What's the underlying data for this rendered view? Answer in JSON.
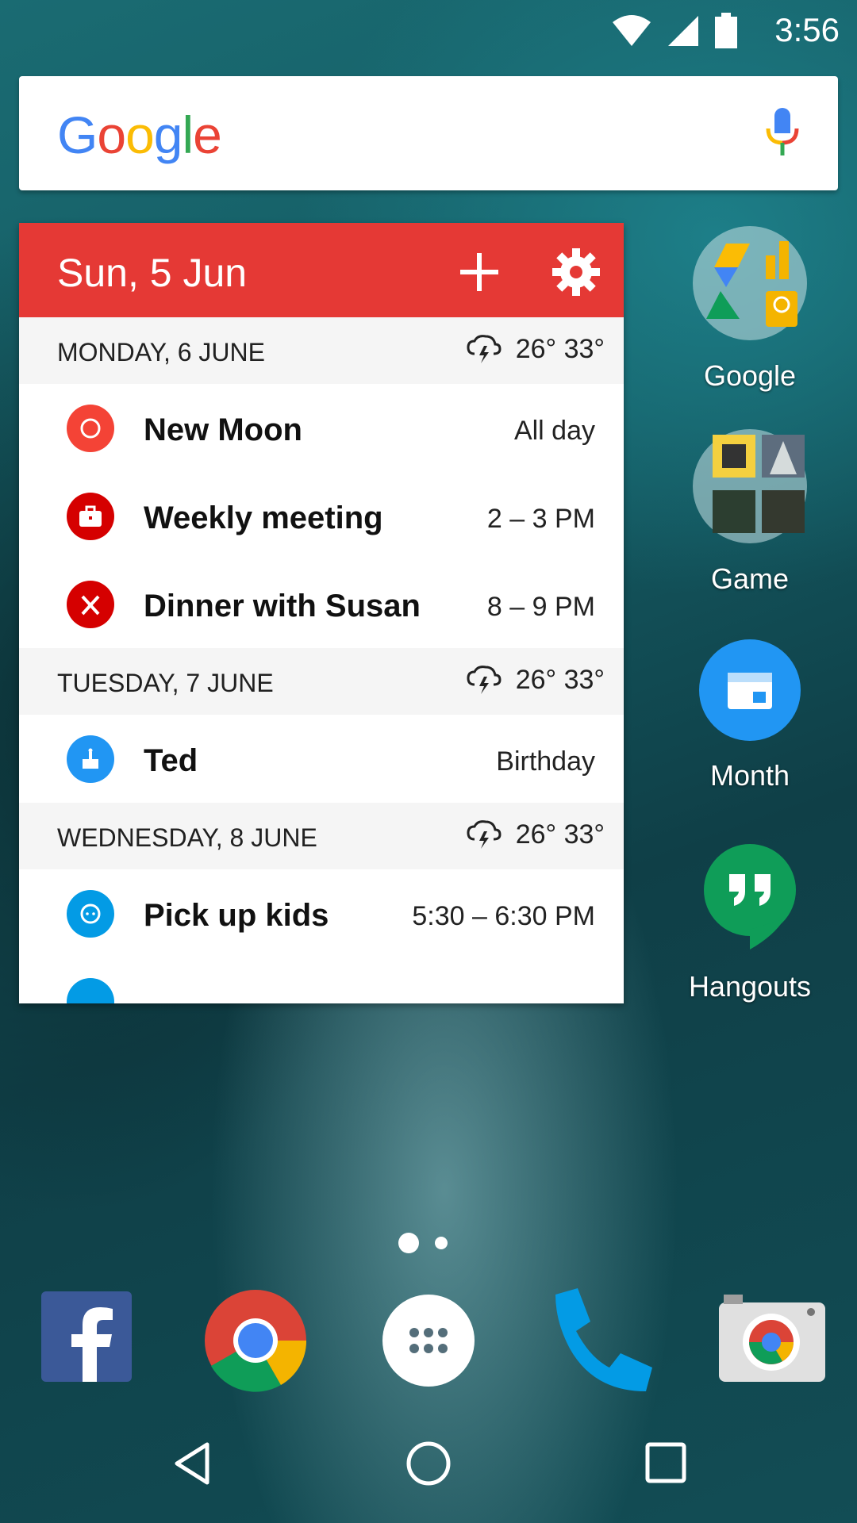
{
  "status": {
    "time": "3:56"
  },
  "search": {
    "logo": "Google"
  },
  "widget": {
    "date": "Sun, 5 Jun",
    "days": [
      {
        "label": "MONDAY, 6 JUNE",
        "temps": "26° 33°",
        "events": [
          {
            "title": "New Moon",
            "time": "All day",
            "color": "#f44336",
            "icon": "moon-icon"
          },
          {
            "title": "Weekly meeting",
            "time": "2 – 3 PM",
            "color": "#d50000",
            "icon": "briefcase-icon"
          },
          {
            "title": "Dinner with Susan",
            "time": "8 – 9 PM",
            "color": "#d50000",
            "icon": "cutlery-icon"
          }
        ]
      },
      {
        "label": "TUESDAY, 7 JUNE",
        "temps": "26° 33°",
        "events": [
          {
            "title": "Ted",
            "time": "Birthday",
            "color": "#2196f3",
            "icon": "cake-icon"
          }
        ]
      },
      {
        "label": "WEDNESDAY, 8 JUNE",
        "temps": "26° 33°",
        "events": [
          {
            "title": "Pick up kids",
            "time": "5:30 – 6:30 PM",
            "color": "#039be5",
            "icon": "kid-icon"
          }
        ]
      }
    ]
  },
  "apps": [
    {
      "label": "Google"
    },
    {
      "label": "Game"
    },
    {
      "label": "Month"
    },
    {
      "label": "Hangouts"
    }
  ],
  "dock": [
    "Facebook",
    "Chrome",
    "Apps",
    "Phone",
    "Camera"
  ],
  "colors": {
    "accent": "#e53935",
    "month": "#2196f3",
    "hangouts": "#0f9d58"
  }
}
